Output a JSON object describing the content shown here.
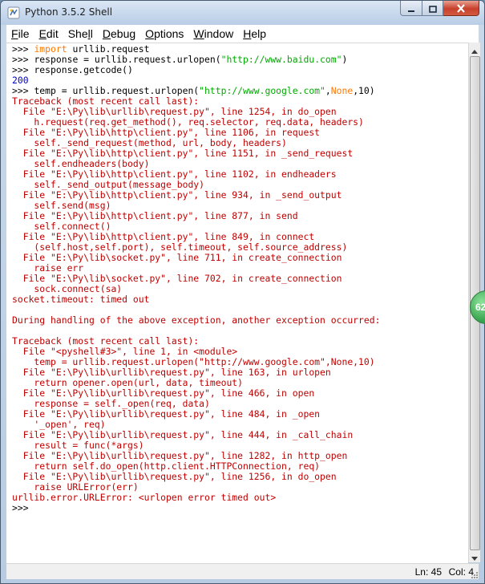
{
  "window": {
    "title": "Python 3.5.2 Shell",
    "icons": {
      "app": "python-shell-icon",
      "minimize": "minimize-icon",
      "maximize": "maximize-icon",
      "close": "close-icon"
    }
  },
  "menu": [
    {
      "pre": "",
      "u": "F",
      "post": "ile"
    },
    {
      "pre": "",
      "u": "E",
      "post": "dit"
    },
    {
      "pre": "She",
      "u": "l",
      "post": "l"
    },
    {
      "pre": "",
      "u": "D",
      "post": "ebug"
    },
    {
      "pre": "",
      "u": "O",
      "post": "ptions"
    },
    {
      "pre": "",
      "u": "W",
      "post": "indow"
    },
    {
      "pre": "",
      "u": "H",
      "post": "elp"
    }
  ],
  "console": {
    "colors": {
      "traceback": "#c00000",
      "output": "#0000c0",
      "keyword": "#ff7700",
      "string": "#00aa00"
    },
    "lines": [
      {
        "prompt": ">>> ",
        "kw": "import",
        "rest": " urllib.request"
      },
      {
        "prompt": ">>> ",
        "before": "response = urllib.request.urlopen(",
        "str": "\"http://www.baidu.com\"",
        "after": ")"
      },
      {
        "prompt": ">>> ",
        "before": "response.getcode()"
      },
      {
        "out": "200"
      },
      {
        "prompt": ">>> ",
        "before": "temp = urllib.request.urlopen(",
        "str": "\"http://www.google.com\"",
        "mid": ",",
        "kw2": "None",
        "after": ",10)"
      },
      {
        "err": "Traceback (most recent call last):"
      },
      {
        "err": "  File \"E:\\Py\\lib\\urllib\\request.py\", line 1254, in do_open"
      },
      {
        "err": "    h.request(req.get_method(), req.selector, req.data, headers)"
      },
      {
        "err": "  File \"E:\\Py\\lib\\http\\client.py\", line 1106, in request"
      },
      {
        "err": "    self._send_request(method, url, body, headers)"
      },
      {
        "err": "  File \"E:\\Py\\lib\\http\\client.py\", line 1151, in _send_request"
      },
      {
        "err": "    self.endheaders(body)"
      },
      {
        "err": "  File \"E:\\Py\\lib\\http\\client.py\", line 1102, in endheaders"
      },
      {
        "err": "    self._send_output(message_body)"
      },
      {
        "err": "  File \"E:\\Py\\lib\\http\\client.py\", line 934, in _send_output"
      },
      {
        "err": "    self.send(msg)"
      },
      {
        "err": "  File \"E:\\Py\\lib\\http\\client.py\", line 877, in send"
      },
      {
        "err": "    self.connect()"
      },
      {
        "err": "  File \"E:\\Py\\lib\\http\\client.py\", line 849, in connect"
      },
      {
        "err": "    (self.host,self.port), self.timeout, self.source_address)"
      },
      {
        "err": "  File \"E:\\Py\\lib\\socket.py\", line 711, in create_connection"
      },
      {
        "err": "    raise err"
      },
      {
        "err": "  File \"E:\\Py\\lib\\socket.py\", line 702, in create_connection"
      },
      {
        "err": "    sock.connect(sa)"
      },
      {
        "err": "socket.timeout: timed out"
      },
      {
        "err": ""
      },
      {
        "err": "During handling of the above exception, another exception occurred:"
      },
      {
        "err": ""
      },
      {
        "err": "Traceback (most recent call last):"
      },
      {
        "err": "  File \"<pyshell#3>\", line 1, in <module>"
      },
      {
        "err": "    temp = urllib.request.urlopen(\"http://www.google.com\",None,10)"
      },
      {
        "err": "  File \"E:\\Py\\lib\\urllib\\request.py\", line 163, in urlopen"
      },
      {
        "err": "    return opener.open(url, data, timeout)"
      },
      {
        "err": "  File \"E:\\Py\\lib\\urllib\\request.py\", line 466, in open"
      },
      {
        "err": "    response = self._open(req, data)"
      },
      {
        "err": "  File \"E:\\Py\\lib\\urllib\\request.py\", line 484, in _open"
      },
      {
        "err": "    '_open', req)"
      },
      {
        "err": "  File \"E:\\Py\\lib\\urllib\\request.py\", line 444, in _call_chain"
      },
      {
        "err": "    result = func(*args)"
      },
      {
        "err": "  File \"E:\\Py\\lib\\urllib\\request.py\", line 1282, in http_open"
      },
      {
        "err": "    return self.do_open(http.client.HTTPConnection, req)"
      },
      {
        "err": "  File \"E:\\Py\\lib\\urllib\\request.py\", line 1256, in do_open"
      },
      {
        "err": "    raise URLError(err)"
      },
      {
        "err": "urllib.error.URLError: <urlopen error timed out>"
      },
      {
        "prompt": ">>> ",
        "before": ""
      }
    ]
  },
  "status": {
    "line": "Ln: 45",
    "col": "Col: 4"
  },
  "floater": {
    "text": "62"
  }
}
